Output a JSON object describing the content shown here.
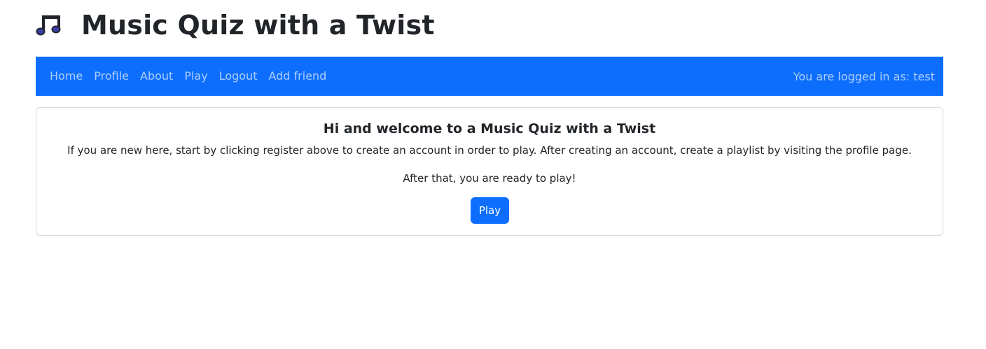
{
  "header": {
    "title": "Music Quiz with a Twist",
    "logo_icon": "music-note-icon"
  },
  "navbar": {
    "links": [
      {
        "label": "Home"
      },
      {
        "label": "Profile"
      },
      {
        "label": "About"
      },
      {
        "label": "Play"
      },
      {
        "label": "Logout"
      },
      {
        "label": "Add friend"
      }
    ],
    "status": "You are logged in as: test"
  },
  "card": {
    "title": "Hi and welcome to a Music Quiz with a Twist",
    "text1": "If you are new here, start by clicking register above to create an account in order to play. After creating an account, create a playlist by visiting the profile page.",
    "text2": "After that, you are ready to play!",
    "play_label": "Play"
  },
  "colors": {
    "primary": "#0d6efd",
    "text": "#212529",
    "logo_fill": "#3b3fa8"
  }
}
